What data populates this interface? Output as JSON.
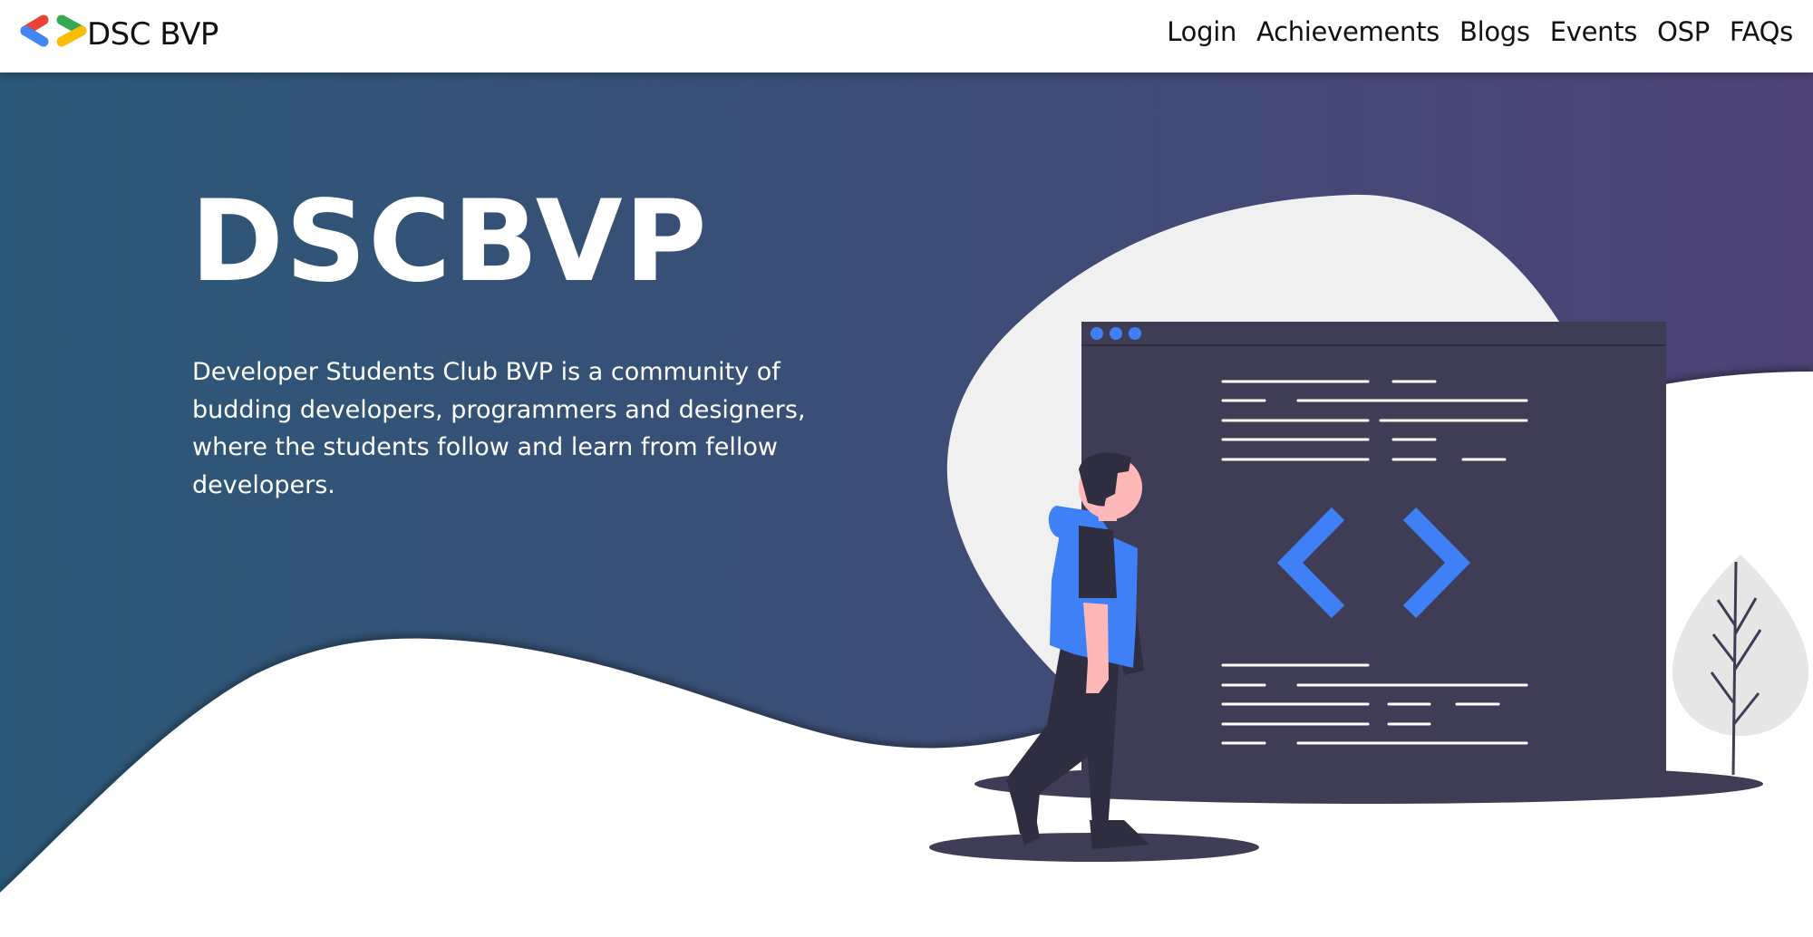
{
  "brand": {
    "name": "DSC BVP",
    "logo_colors": [
      "#ea4335",
      "#4285f4",
      "#34a853",
      "#fbbc04"
    ]
  },
  "nav": {
    "links": [
      "Login",
      "Achievements",
      "Blogs",
      "Events",
      "OSP",
      "FAQs"
    ]
  },
  "hero": {
    "title": "DSCBVP",
    "description": "Developer Students Club BVP is a community of budding developers, programmers and designers, where the students follow and learn from fellow developers.",
    "gradient": [
      "#2b5876",
      "#4e4376"
    ]
  },
  "illustration": {
    "name": "developer-with-code-window",
    "accent": "#3f80f6",
    "window_color": "#3f3d56",
    "blob_color": "#f0f0f0"
  }
}
